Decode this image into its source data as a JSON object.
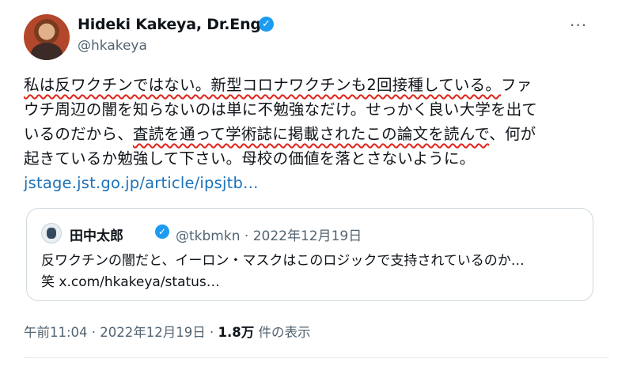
{
  "author": {
    "display_name": "Hideki Kakeya, Dr.Eng.",
    "handle": "@hkakeya",
    "verified_icon": "verified-badge-icon"
  },
  "more_icon": "···",
  "tweet": {
    "lines": [
      [
        "私は反ワクチンではない。新型コロナワクチンも2回接種している。",
        "ファ"
      ],
      [
        "ウチ周辺の闇を知らないのは単に不勉強なだけ。せっかく良い大学を出て"
      ],
      [
        "いるのだから、",
        "査読を通って学術誌に掲載されたこの論文を読んで",
        "、何が"
      ],
      [
        "起きているか勉強して下さい。母校の価値を落とさないように。"
      ]
    ],
    "link": "jstage.jst.go.jp/article/ipsjtb…"
  },
  "quote": {
    "display_name": "田中太郎",
    "handle_date": "@tkbmkn · 2022年12月19日",
    "line1": "反ワクチンの闇だと、イーロン・マスクはこのロジックで支持されているのか…",
    "line2": "笑 x.com/hkakeya/status…"
  },
  "meta": {
    "time_date": "午前11:04 · 2022年12月19日 · ",
    "views_count": "1.8万",
    "views_label": " 件の表示"
  },
  "colors": {
    "accent": "#1d9bf0",
    "underline": "#e0241b",
    "link": "#1d72b8"
  }
}
